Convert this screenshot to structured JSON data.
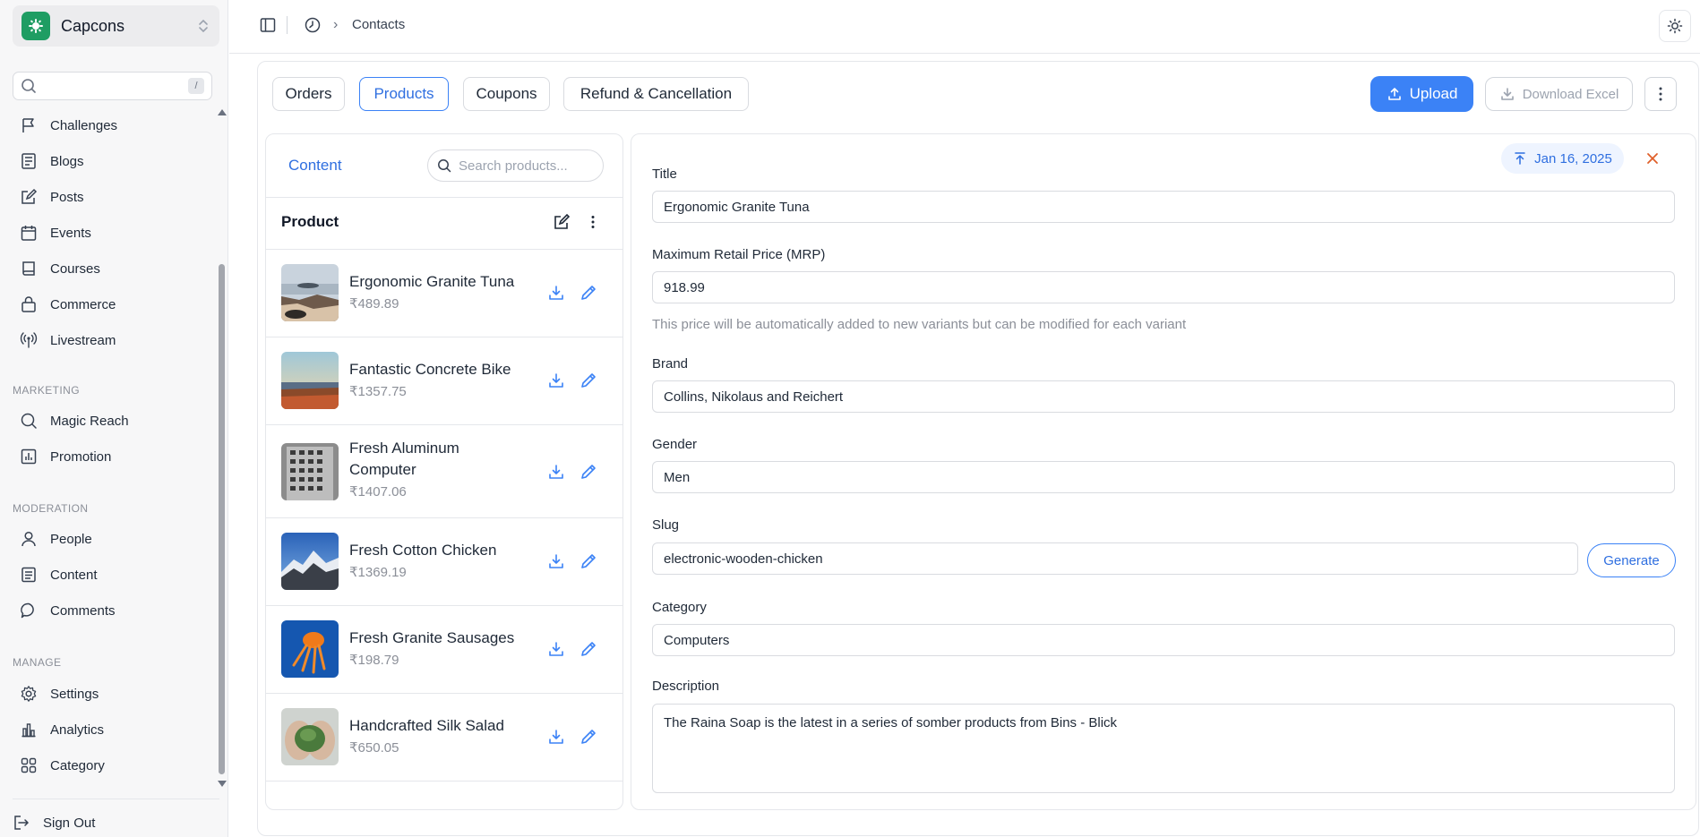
{
  "sidebar": {
    "workspace_name": "Capcons",
    "search_shortcut": "/",
    "items_top": [
      {
        "label": "Challenges",
        "icon": "flag-icon"
      },
      {
        "label": "Blogs",
        "icon": "document-list-icon"
      },
      {
        "label": "Posts",
        "icon": "edit-square-icon"
      },
      {
        "label": "Events",
        "icon": "calendar-icon"
      },
      {
        "label": "Courses",
        "icon": "book-icon"
      },
      {
        "label": "Commerce",
        "icon": "lock-bag-icon"
      },
      {
        "label": "Livestream",
        "icon": "broadcast-icon"
      }
    ],
    "marketing_title": "MARKETING",
    "marketing_items": [
      {
        "label": "Magic Reach",
        "icon": "search-icon"
      },
      {
        "label": "Promotion",
        "icon": "bar-chart-icon"
      }
    ],
    "moderation_title": "MODERATION",
    "moderation_items": [
      {
        "label": "People",
        "icon": "user-icon"
      },
      {
        "label": "Content",
        "icon": "document-icon"
      },
      {
        "label": "Comments",
        "icon": "chat-bubble-icon"
      }
    ],
    "manage_title": "MANAGE",
    "manage_items": [
      {
        "label": "Settings",
        "icon": "gear-icon"
      },
      {
        "label": "Analytics",
        "icon": "analytics-icon"
      },
      {
        "label": "Category",
        "icon": "grid-icon"
      }
    ],
    "signout_label": "Sign Out"
  },
  "topbar": {
    "breadcrumb_current": "Contacts",
    "breadcrumb_separator": "›"
  },
  "tabs": [
    {
      "label": "Orders",
      "active": false
    },
    {
      "label": "Products",
      "active": true
    },
    {
      "label": "Coupons",
      "active": false
    },
    {
      "label": "Refund & Cancellation",
      "active": false
    }
  ],
  "actions": {
    "upload_label": "Upload",
    "download_label": "Download Excel"
  },
  "list": {
    "tab_label": "Content",
    "search_placeholder": "Search products...",
    "header": "Product",
    "products": [
      {
        "name": "Ergonomic Granite Tuna",
        "price": "₹489.89"
      },
      {
        "name": "Fantastic Concrete Bike",
        "price": "₹1357.75"
      },
      {
        "name": "Fresh Aluminum Computer",
        "price": "₹1407.06"
      },
      {
        "name": "Fresh Cotton Chicken",
        "price": "₹1369.19"
      },
      {
        "name": "Fresh Granite Sausages",
        "price": "₹198.79"
      },
      {
        "name": "Handcrafted Silk Salad",
        "price": "₹650.05"
      }
    ]
  },
  "form": {
    "date": "Jan 16, 2025",
    "title_label": "Title",
    "title_value": "Ergonomic Granite Tuna",
    "mrp_label": "Maximum Retail Price (MRP)",
    "mrp_value": "918.99",
    "mrp_help": "This price will be automatically added to new variants but can be modified for each variant",
    "brand_label": "Brand",
    "brand_value": "Collins, Nikolaus and Reichert",
    "gender_label": "Gender",
    "gender_value": "Men",
    "slug_label": "Slug",
    "slug_value": "electronic-wooden-chicken",
    "generate_label": "Generate",
    "category_label": "Category",
    "category_value": "Computers",
    "description_label": "Description",
    "description_value": "The Raina Soap is the latest in a series of somber products from Bins - Blick"
  },
  "colors": {
    "accent": "#3b82f6",
    "brand_logo": "#1f9d63",
    "close": "#e0602a"
  }
}
